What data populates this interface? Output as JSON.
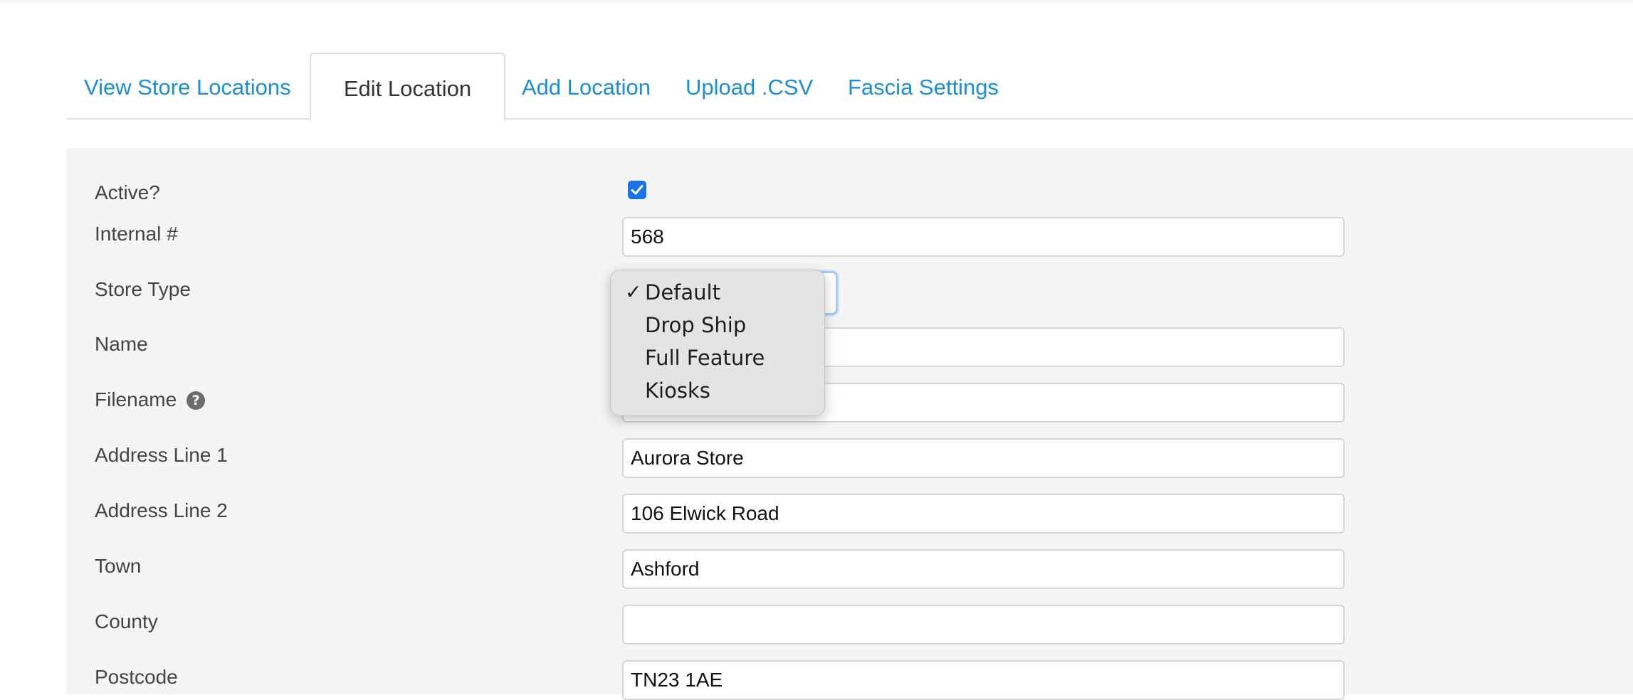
{
  "tabs": [
    {
      "label": "View Store Locations",
      "active": false
    },
    {
      "label": "Edit Location",
      "active": true
    },
    {
      "label": "Add Location",
      "active": false
    },
    {
      "label": "Upload .CSV",
      "active": false
    },
    {
      "label": "Fascia Settings",
      "active": false
    }
  ],
  "form": {
    "active": {
      "label": "Active?",
      "checked": true
    },
    "internal_number": {
      "label": "Internal #",
      "value": "568"
    },
    "store_type": {
      "label": "Store Type",
      "selected": "Default",
      "options": [
        "Default",
        "Drop Ship",
        "Full Feature",
        "Kiosks"
      ],
      "check_glyph": "✓"
    },
    "name": {
      "label": "Name",
      "value": ""
    },
    "filename": {
      "label": "Filename",
      "value": "",
      "help_icon": "question-circle-icon",
      "help_glyph": "?"
    },
    "address_line_1": {
      "label": "Address Line 1",
      "value": "Aurora Store"
    },
    "address_line_2": {
      "label": "Address Line 2",
      "value": "106 Elwick Road"
    },
    "town": {
      "label": "Town",
      "value": "Ashford"
    },
    "county": {
      "label": "County",
      "value": ""
    },
    "postcode": {
      "label": "Postcode",
      "value": "TN23 1AE"
    }
  },
  "colors": {
    "link": "#1a8fd6",
    "panel_bg": "#f5f5f5",
    "checkbox": "#1a73e8",
    "dropdown_bg": "#e4e4e3"
  }
}
